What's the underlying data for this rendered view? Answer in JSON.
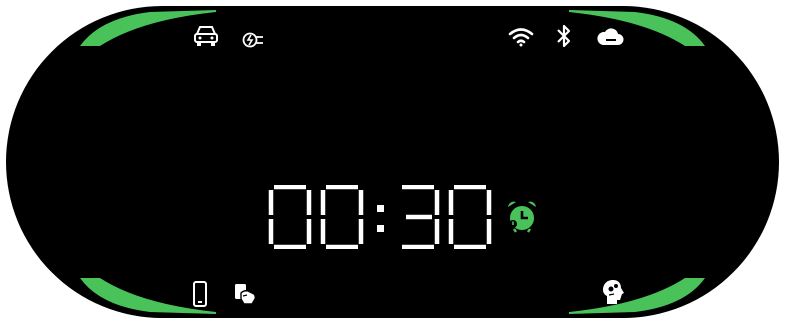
{
  "display": {
    "background": "#000000",
    "accent": "#4ac25a",
    "foreground": "#ffffff"
  },
  "status_bar": {
    "left_icons": [
      "car-icon",
      "ev-charging-plug-icon"
    ],
    "right_icons": [
      "wifi-icon",
      "bluetooth-icon",
      "cloud-icon"
    ]
  },
  "clock": {
    "time": "00:30",
    "digits": [
      "0",
      "0",
      "3",
      "0"
    ]
  },
  "alarm": {
    "icon": "alarm-clock-icon",
    "color": "#4ac25a"
  },
  "bottom_bar": {
    "left_icons": [
      "smartphone-icon",
      "hand-card-icon"
    ],
    "right_icons": [
      "head-profile-icon"
    ]
  }
}
